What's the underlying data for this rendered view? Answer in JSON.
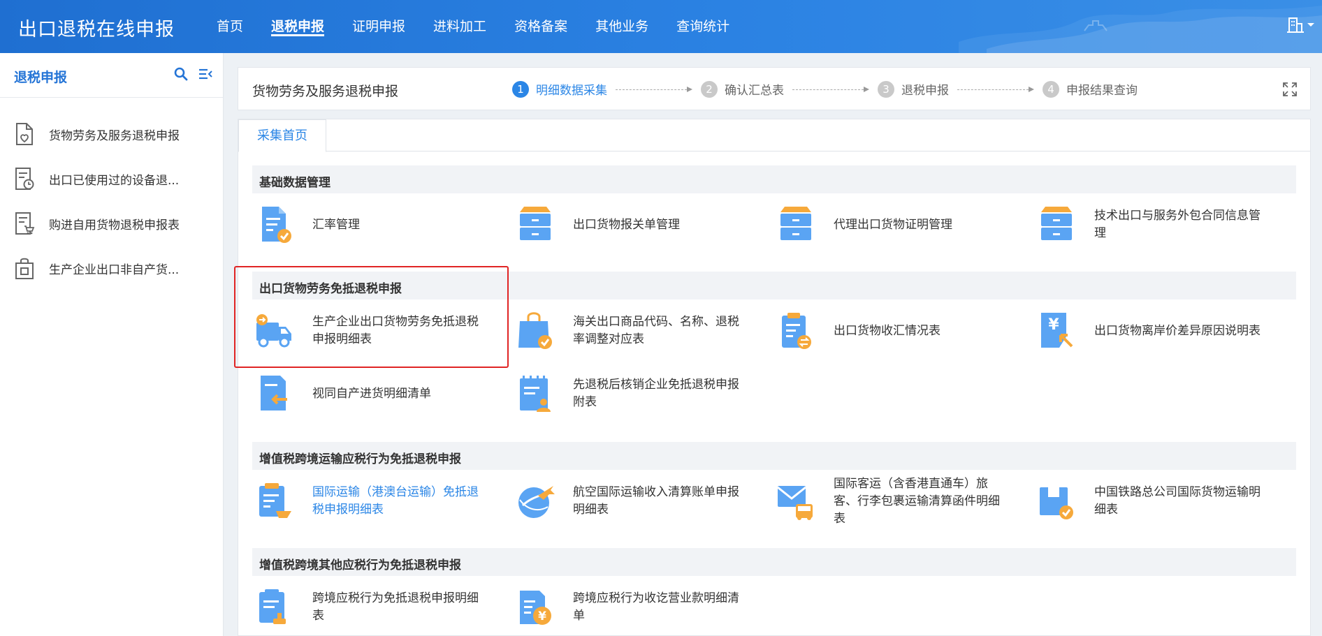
{
  "app": {
    "title": "出口退税在线申报"
  },
  "nav": [
    {
      "label": "首页",
      "active": false
    },
    {
      "label": "退税申报",
      "active": true
    },
    {
      "label": "证明申报",
      "active": false
    },
    {
      "label": "进料加工",
      "active": false
    },
    {
      "label": "资格备案",
      "active": false
    },
    {
      "label": "其他业务",
      "active": false
    },
    {
      "label": "查询统计",
      "active": false
    }
  ],
  "sidebar": {
    "title": "退税申报",
    "items": [
      {
        "label": "货物劳务及服务退税申报",
        "icon": "doc-heart-icon"
      },
      {
        "label": "出口已使用过的设备退...",
        "icon": "doc-clock-icon"
      },
      {
        "label": "购进自用货物退税申报表",
        "icon": "doc-cart-icon"
      },
      {
        "label": "生产企业出口非自产货...",
        "icon": "bag-icon"
      }
    ]
  },
  "steps_bar": {
    "title": "货物劳务及服务退税申报",
    "steps": [
      {
        "num": "1",
        "label": "明细数据采集",
        "active": true
      },
      {
        "num": "2",
        "label": "确认汇总表",
        "active": false
      },
      {
        "num": "3",
        "label": "退税申报",
        "active": false
      },
      {
        "num": "4",
        "label": "申报结果查询",
        "active": false
      }
    ]
  },
  "tab": {
    "label": "采集首页"
  },
  "sections": [
    {
      "title": "基础数据管理",
      "items": [
        {
          "label": "汇率管理",
          "icon": "doc-check-icon",
          "link": false
        },
        {
          "label": "出口货物报关单管理",
          "icon": "cabinet-icon",
          "link": false
        },
        {
          "label": "代理出口货物证明管理",
          "icon": "cabinet-icon",
          "link": false
        },
        {
          "label": "技术出口与服务外包合同信息管理",
          "icon": "cabinet-icon",
          "link": false
        }
      ]
    },
    {
      "title": "出口货物劳务免抵退税申报",
      "items": [
        {
          "label": "生产企业出口货物劳务免抵退税申报明细表",
          "icon": "truck-icon",
          "link": false
        },
        {
          "label": "海关出口商品代码、名称、退税率调整对应表",
          "icon": "shopping-bag-icon",
          "link": false
        },
        {
          "label": "出口货物收汇情况表",
          "icon": "clipboard-exchange-icon",
          "link": false
        },
        {
          "label": "出口货物离岸价差异原因说明表",
          "icon": "yen-doc-icon",
          "link": false
        },
        {
          "label": "视同自产进货明细清单",
          "icon": "doc-import-icon",
          "link": false
        },
        {
          "label": "先退税后核销企业免抵退税申报附表",
          "icon": "calendar-user-icon",
          "link": false
        }
      ]
    },
    {
      "title": "增值税跨境运输应税行为免抵退税申报",
      "items": [
        {
          "label": "国际运输（港澳台运输）免抵退税申报明细表",
          "icon": "clipboard-ship-icon",
          "link": true
        },
        {
          "label": "航空国际运输收入清算账单申报明细表",
          "icon": "airplane-icon",
          "link": false
        },
        {
          "label": "国际客运（含香港直通车）旅客、行李包裹运输清算函件明细表",
          "icon": "mail-bus-icon",
          "link": false
        },
        {
          "label": "中国铁路总公司国际货物运输明细表",
          "icon": "box-check-icon",
          "link": false
        }
      ]
    },
    {
      "title": "增值税跨境其他应税行为免抵退税申报",
      "items": [
        {
          "label": "跨境应税行为免抵退税申报明细表",
          "icon": "clipboard-stamp-icon",
          "link": false
        },
        {
          "label": "跨境应税行为收讫营业款明细清单",
          "icon": "doc-yen-icon",
          "link": false
        }
      ]
    }
  ],
  "colors": {
    "primary": "#2b86e6",
    "icon_blue": "#5aa4f3",
    "icon_orange": "#f6a93b",
    "highlight": "#e02424"
  }
}
